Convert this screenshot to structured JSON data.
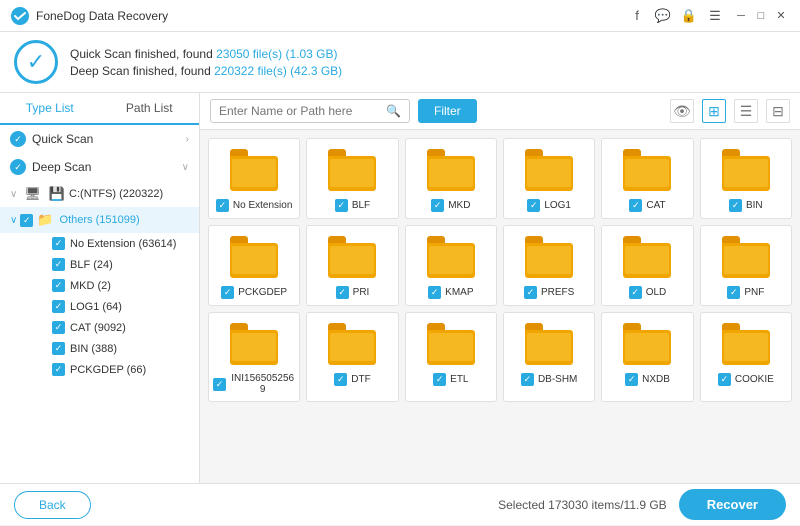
{
  "app": {
    "title": "FoneDog Data Recovery"
  },
  "titlebar": {
    "icons": [
      "facebook",
      "message",
      "lock",
      "menu",
      "minimize",
      "maximize",
      "close"
    ]
  },
  "header": {
    "quick_scan_line": "Quick Scan finished, found 23050 file(s) (1.03 GB)",
    "quick_scan_highlight": "23050 file(s) (1.03 GB)",
    "deep_scan_line": "Deep Scan finished, found 220322 file(s) (42.3 GB)",
    "deep_scan_highlight": "220322 file(s) (42.3 GB)"
  },
  "sidebar": {
    "tab_type": "Type List",
    "tab_path": "Path List",
    "quick_scan_label": "Quick Scan",
    "deep_scan_label": "Deep Scan",
    "drive_label": "C:(NTFS) (220322)",
    "others_label": "Others (151099)",
    "subitems": [
      {
        "label": "No Extension (63614)",
        "checked": true
      },
      {
        "label": "BLF (24)",
        "checked": true
      },
      {
        "label": "MKD (2)",
        "checked": true
      },
      {
        "label": "LOG1 (64)",
        "checked": true
      },
      {
        "label": "CAT (9092)",
        "checked": true
      },
      {
        "label": "BIN (388)",
        "checked": true
      },
      {
        "label": "PCKGDEP (66)",
        "checked": true
      }
    ]
  },
  "toolbar": {
    "search_placeholder": "Enter Name or Path here",
    "filter_label": "Filter"
  },
  "file_grid": {
    "items": [
      {
        "label": "No Extension",
        "checked": true
      },
      {
        "label": "BLF",
        "checked": true
      },
      {
        "label": "MKD",
        "checked": true
      },
      {
        "label": "LOG1",
        "checked": true
      },
      {
        "label": "CAT",
        "checked": true
      },
      {
        "label": "BIN",
        "checked": true
      },
      {
        "label": "PCKGDEP",
        "checked": true
      },
      {
        "label": "PRI",
        "checked": true
      },
      {
        "label": "KMAP",
        "checked": true
      },
      {
        "label": "PREFS",
        "checked": true
      },
      {
        "label": "OLD",
        "checked": true
      },
      {
        "label": "PNF",
        "checked": true
      },
      {
        "label": "INI1565052569",
        "checked": true
      },
      {
        "label": "DTF",
        "checked": true
      },
      {
        "label": "ETL",
        "checked": true
      },
      {
        "label": "DB-SHM",
        "checked": true
      },
      {
        "label": "NXDB",
        "checked": true
      },
      {
        "label": "COOKIE",
        "checked": true
      }
    ]
  },
  "footer": {
    "back_label": "Back",
    "status": "Selected 173030 items/11.9 GB",
    "recover_label": "Recover"
  }
}
